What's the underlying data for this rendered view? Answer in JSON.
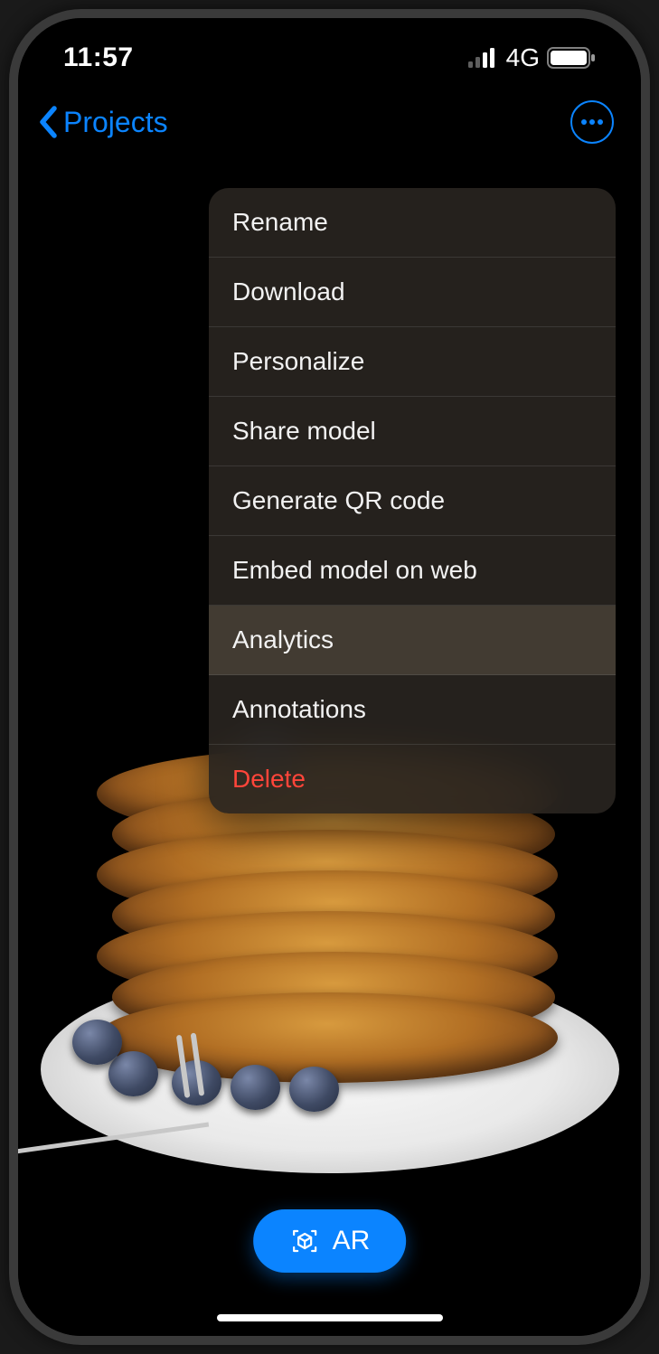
{
  "statusBar": {
    "time": "11:57",
    "network": "4G"
  },
  "nav": {
    "backLabel": "Projects"
  },
  "menu": {
    "items": [
      {
        "label": "Rename",
        "highlighted": false,
        "destructive": false
      },
      {
        "label": "Download",
        "highlighted": false,
        "destructive": false
      },
      {
        "label": "Personalize",
        "highlighted": false,
        "destructive": false
      },
      {
        "label": "Share model",
        "highlighted": false,
        "destructive": false
      },
      {
        "label": "Generate QR code",
        "highlighted": false,
        "destructive": false
      },
      {
        "label": "Embed model on web",
        "highlighted": false,
        "destructive": false
      },
      {
        "label": "Analytics",
        "highlighted": true,
        "destructive": false
      },
      {
        "label": "Annotations",
        "highlighted": false,
        "destructive": false
      },
      {
        "label": "Delete",
        "highlighted": false,
        "destructive": true
      }
    ]
  },
  "arButton": {
    "label": "AR"
  }
}
